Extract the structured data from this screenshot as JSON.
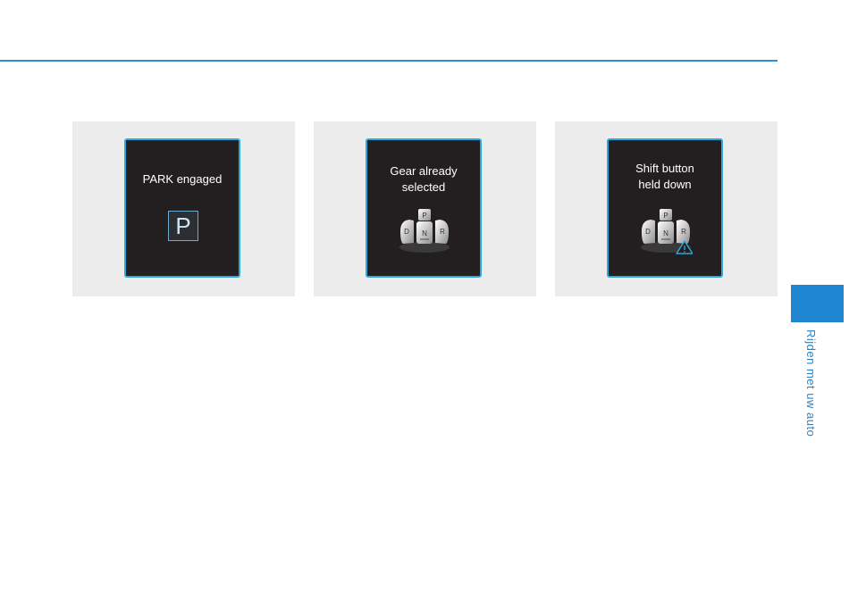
{
  "panels": [
    {
      "message": "PARK engaged",
      "icon": "park-indicator",
      "gear_letter": "P"
    },
    {
      "message": "Gear already\nselected",
      "icon": "gear-buttons-icon",
      "buttons": {
        "top": "P",
        "left": "D",
        "center": "N",
        "right": "R"
      }
    },
    {
      "message": "Shift button\nheld down",
      "icon": "gear-buttons-warning-icon",
      "buttons": {
        "top": "P",
        "left": "D",
        "center": "N",
        "right": "R"
      }
    }
  ],
  "sidebar": {
    "label": "Rijden met uw auto"
  },
  "colors": {
    "accent": "#1f87d2",
    "screen_border": "#29a9e0",
    "screen_bg": "#231f20",
    "panel_bg": "#ececec",
    "warning": "#29a9e0"
  }
}
